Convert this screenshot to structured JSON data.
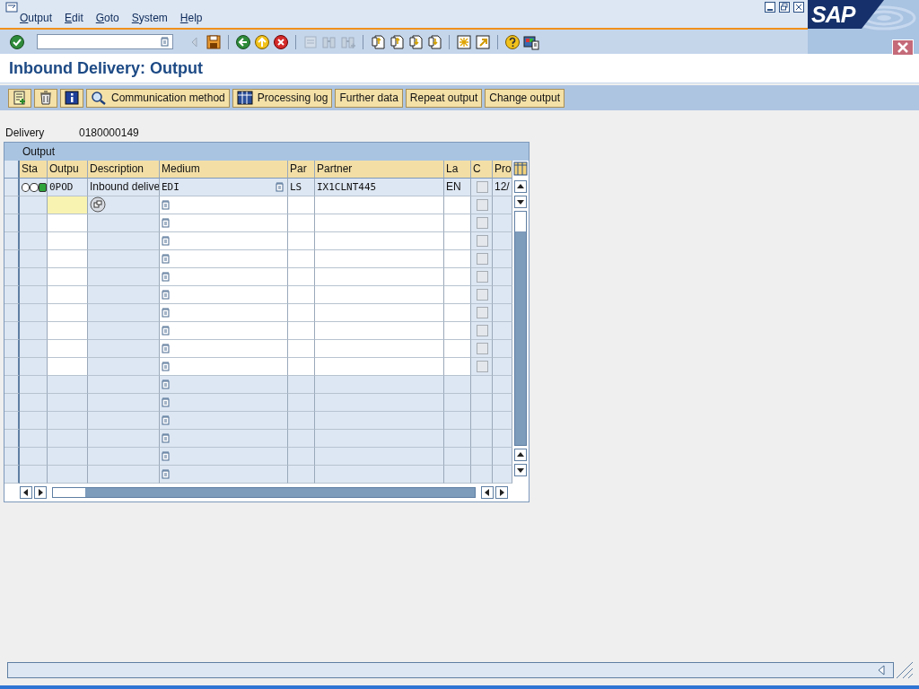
{
  "menu": [
    "Output",
    "Edit",
    "Goto",
    "System",
    "Help"
  ],
  "logo": "SAP",
  "toolbar": [
    {
      "kind": "enter",
      "disabled": false
    },
    {
      "kind": "command"
    },
    {
      "kind": "back-small",
      "disabled": true
    },
    {
      "kind": "save",
      "disabled": false
    },
    {
      "kind": "separator"
    },
    {
      "kind": "back",
      "disabled": false
    },
    {
      "kind": "exit",
      "disabled": false
    },
    {
      "kind": "cancel",
      "disabled": false
    },
    {
      "kind": "separator"
    },
    {
      "kind": "print",
      "disabled": true
    },
    {
      "kind": "find",
      "disabled": true
    },
    {
      "kind": "find-next",
      "disabled": true
    },
    {
      "kind": "separator"
    },
    {
      "kind": "first-page",
      "disabled": false
    },
    {
      "kind": "prev-page",
      "disabled": false
    },
    {
      "kind": "next-page",
      "disabled": false
    },
    {
      "kind": "last-page",
      "disabled": false
    },
    {
      "kind": "separator"
    },
    {
      "kind": "new-session",
      "disabled": false
    },
    {
      "kind": "shortcut",
      "disabled": false
    },
    {
      "kind": "separator"
    },
    {
      "kind": "help",
      "disabled": false
    },
    {
      "kind": "layout",
      "disabled": false
    }
  ],
  "title": "Inbound Delivery: Output",
  "app_toolbar": [
    {
      "kind": "details"
    },
    {
      "kind": "delete"
    },
    {
      "kind": "info"
    },
    {
      "kind": "search",
      "label": "Communication method"
    },
    {
      "kind": "table",
      "label": "Processing log"
    },
    {
      "kind": "text",
      "label": "Further data"
    },
    {
      "kind": "text",
      "label": "Repeat output"
    },
    {
      "kind": "text",
      "label": "Change output"
    }
  ],
  "delivery": {
    "label": "Delivery",
    "value": "0180000149"
  },
  "table": {
    "title": "Output",
    "columns": [
      "Sta",
      "Outpu",
      "Description",
      "Medium",
      "Par",
      "Partner",
      "La",
      "C",
      "Pro"
    ],
    "rows": [
      {
        "kind": "filled",
        "lights": [
          {
            "on": false
          },
          {
            "on": false
          },
          {
            "on": true
          }
        ],
        "output": "0POD",
        "description": "Inbound delive",
        "medium": "EDI",
        "partner_function": "LS",
        "partner": "IX1CLNT445",
        "language": "EN",
        "checked": false,
        "processing": "12/"
      },
      {
        "kind": "input",
        "focused": true,
        "detail_button": true,
        "checked": false
      },
      {
        "kind": "input",
        "focused": false,
        "checked": false
      },
      {
        "kind": "input",
        "focused": false,
        "checked": false
      },
      {
        "kind": "input",
        "focused": false,
        "checked": false
      },
      {
        "kind": "input",
        "focused": false,
        "checked": false
      },
      {
        "kind": "input",
        "focused": false,
        "checked": false
      },
      {
        "kind": "input",
        "focused": false,
        "checked": false
      },
      {
        "kind": "input",
        "focused": false,
        "checked": false
      },
      {
        "kind": "input",
        "focused": false,
        "checked": false
      },
      {
        "kind": "input",
        "focused": false,
        "checked": false
      },
      {
        "kind": "blank"
      },
      {
        "kind": "blank"
      },
      {
        "kind": "blank"
      },
      {
        "kind": "blank"
      },
      {
        "kind": "blank"
      },
      {
        "kind": "blank"
      }
    ]
  }
}
